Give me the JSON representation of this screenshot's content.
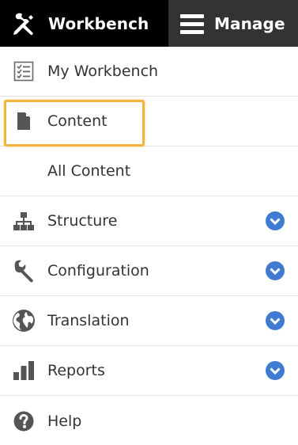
{
  "toolbar": {
    "workbench_label": "Workbench",
    "manage_label": "Manage"
  },
  "menu": {
    "items": [
      {
        "label": "My Workbench",
        "icon": "checklist-icon",
        "expandable": false
      },
      {
        "label": "Content",
        "icon": "document-icon",
        "expandable": false,
        "highlighted": true
      },
      {
        "label": "All Content",
        "icon": "",
        "expandable": false,
        "sub": true
      },
      {
        "label": "Structure",
        "icon": "sitemap-icon",
        "expandable": true
      },
      {
        "label": "Configuration",
        "icon": "wrench-icon",
        "expandable": true
      },
      {
        "label": "Translation",
        "icon": "globe-icon",
        "expandable": true
      },
      {
        "label": "Reports",
        "icon": "bar-chart-icon",
        "expandable": true
      },
      {
        "label": "Help",
        "icon": "question-icon",
        "expandable": false
      }
    ]
  },
  "colors": {
    "workbench_bg": "#000000",
    "manage_bg": "#333333",
    "text": "#333333",
    "icon": "#555555",
    "chevron": "#3f7bd0",
    "highlight": "#f2b43a",
    "divider": "#e2e2e2"
  }
}
